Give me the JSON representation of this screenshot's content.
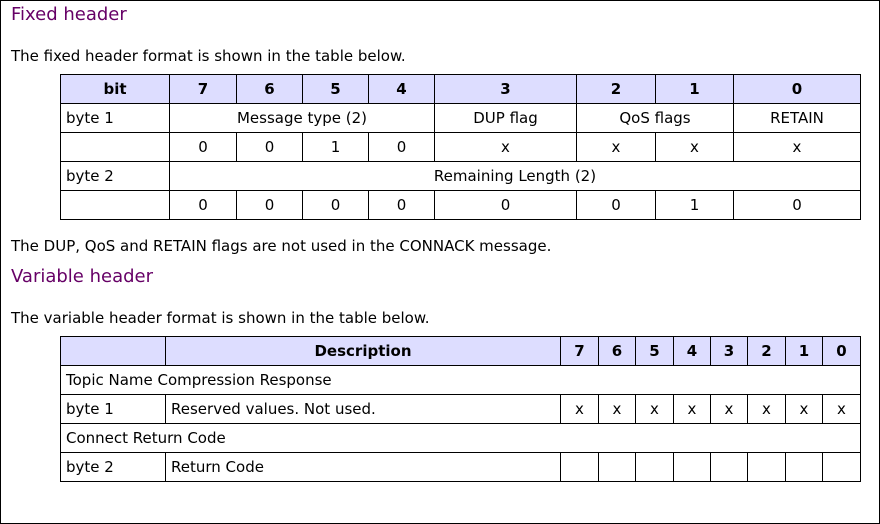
{
  "fixed_header": {
    "heading": "Fixed header",
    "intro": "The fixed header format is shown in the table below.",
    "table": {
      "header": [
        "bit",
        "7",
        "6",
        "5",
        "4",
        "3",
        "2",
        "1",
        "0"
      ],
      "byte1_label": "byte 1",
      "message_type": "Message type (2)",
      "dup_flag": "DUP flag",
      "qos_flags": "QoS flags",
      "retain": "RETAIN",
      "byte1_values": [
        "0",
        "0",
        "1",
        "0",
        "x",
        "x",
        "x",
        "x"
      ],
      "byte2_label": "byte 2",
      "remaining_length": "Remaining Length (2)",
      "byte2_values": [
        "0",
        "0",
        "0",
        "0",
        "0",
        "0",
        "1",
        "0"
      ]
    },
    "note": "The DUP, QoS and RETAIN flags are not used in the CONNACK message."
  },
  "variable_header": {
    "heading": "Variable header",
    "intro": "The variable header format is shown in the table below.",
    "table": {
      "header": [
        "",
        "Description",
        "7",
        "6",
        "5",
        "4",
        "3",
        "2",
        "1",
        "0"
      ],
      "section1": "Topic Name Compression Response",
      "row1": {
        "label": "byte 1",
        "description": "Reserved values. Not used.",
        "bits": [
          "x",
          "x",
          "x",
          "x",
          "x",
          "x",
          "x",
          "x"
        ]
      },
      "section2": "Connect Return Code",
      "row2": {
        "label": "byte 2",
        "description": "Return Code",
        "bits": [
          "",
          "",
          "",
          "",
          "",
          "",
          "",
          ""
        ]
      }
    }
  }
}
